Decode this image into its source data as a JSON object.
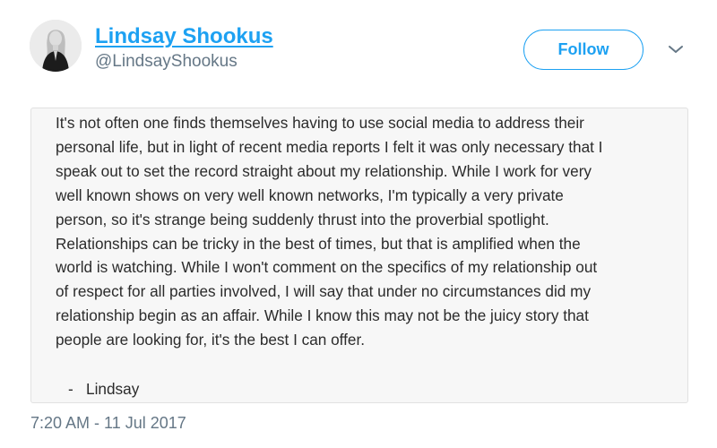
{
  "author": {
    "display_name": "Lindsay Shookus",
    "handle": "@LindsayShookus"
  },
  "follow_label": "Follow",
  "icons": {
    "avatar": "profile-photo",
    "menu": "chevron-down-icon"
  },
  "colors": {
    "accent": "#1da1f2",
    "secondary_text": "#657786",
    "card_background": "#f7f7f7"
  },
  "statement": {
    "body": "It's not often one finds themselves having to use social media to address their\npersonal life, but in light of recent media reports I felt it was only necessary that I\nspeak out to set the record straight about my relationship. While I work for very\nwell known shows on very well known networks, I'm typically a very private\nperson, so it's strange being suddenly thrust into the proverbial spotlight.\nRelationships can be tricky in the best of times, but that is amplified when the\nworld is watching. While I won't comment on the specifics of my relationship out\nof respect for all parties involved, I will say that under no circumstances did my\nrelationship begin as an affair. While I know this may not be the juicy story that\npeople are looking for, it's the best I can offer.",
    "signature": "-   Lindsay"
  },
  "timestamp": "7:20 AM - 11 Jul 2017"
}
